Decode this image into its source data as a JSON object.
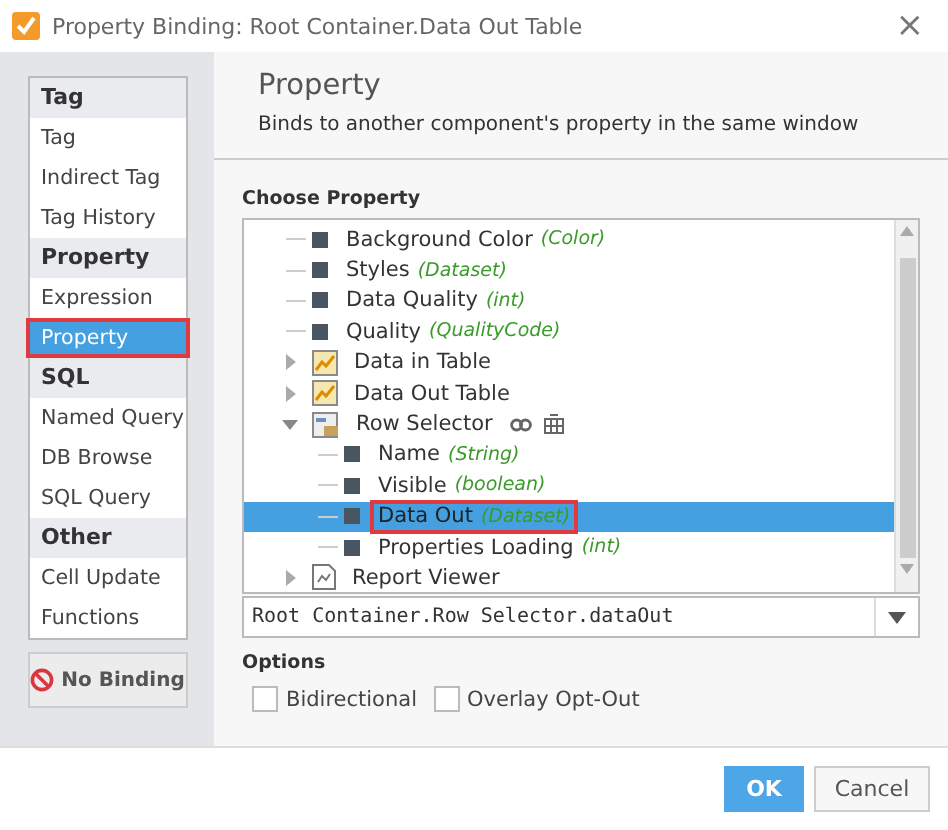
{
  "window": {
    "title": "Property Binding: Root Container.Data Out Table",
    "close": "×"
  },
  "sidebar": {
    "items": [
      {
        "kind": "header",
        "label": "Tag"
      },
      {
        "kind": "item",
        "label": "Tag",
        "selected": false,
        "outlined": false
      },
      {
        "kind": "item",
        "label": "Indirect Tag",
        "selected": false,
        "outlined": false
      },
      {
        "kind": "item",
        "label": "Tag History",
        "selected": false,
        "outlined": false
      },
      {
        "kind": "header",
        "label": "Property"
      },
      {
        "kind": "item",
        "label": "Expression",
        "selected": false,
        "outlined": false
      },
      {
        "kind": "item",
        "label": "Property",
        "selected": true,
        "outlined": true
      },
      {
        "kind": "header",
        "label": "SQL"
      },
      {
        "kind": "item",
        "label": "Named Query",
        "selected": false,
        "outlined": false
      },
      {
        "kind": "item",
        "label": "DB Browse",
        "selected": false,
        "outlined": false
      },
      {
        "kind": "item",
        "label": "SQL Query",
        "selected": false,
        "outlined": false
      },
      {
        "kind": "header",
        "label": "Other"
      },
      {
        "kind": "item",
        "label": "Cell Update",
        "selected": false,
        "outlined": false
      },
      {
        "kind": "item",
        "label": "Functions",
        "selected": false,
        "outlined": false
      }
    ],
    "no_binding": "No Binding"
  },
  "header": {
    "title": "Property",
    "subtitle": "Binds to another component's property in the same window"
  },
  "choose_property": {
    "label": "Choose Property",
    "tree": [
      {
        "kind": "property",
        "label": "Background Color",
        "type": "(Color)",
        "selected": false,
        "outlined": false
      },
      {
        "kind": "property",
        "label": "Styles",
        "type": "(Dataset)",
        "selected": false,
        "outlined": false
      },
      {
        "kind": "property",
        "label": "Data Quality",
        "type": "(int)",
        "selected": false,
        "outlined": false
      },
      {
        "kind": "property",
        "label": "Quality",
        "type": "(QualityCode)",
        "selected": false,
        "outlined": false
      },
      {
        "kind": "table",
        "label": "Data in Table",
        "expanded": false,
        "selected": false,
        "outlined": false
      },
      {
        "kind": "table",
        "label": "Data Out Table",
        "expanded": false,
        "selected": false,
        "outlined": false
      },
      {
        "kind": "component",
        "label": "Row Selector",
        "expanded": true,
        "selected": false,
        "outlined": false,
        "children": [
          {
            "kind": "property",
            "label": "Name",
            "type": "(String)",
            "selected": false,
            "outlined": false
          },
          {
            "kind": "property",
            "label": "Visible",
            "type": "(boolean)",
            "selected": false,
            "outlined": false
          },
          {
            "kind": "property",
            "label": "Data Out",
            "type": "(Dataset)",
            "selected": true,
            "outlined": true
          },
          {
            "kind": "property",
            "label": "Properties Loading",
            "type": "(int)",
            "selected": false,
            "outlined": false
          }
        ]
      },
      {
        "kind": "report",
        "label": "Report Viewer",
        "expanded": false,
        "selected": false,
        "outlined": false
      }
    ],
    "path": "Root Container.Row Selector.dataOut"
  },
  "options": {
    "label": "Options",
    "checkboxes": [
      {
        "label": "Bidirectional",
        "checked": false
      },
      {
        "label": "Overlay Opt-Out",
        "checked": false
      }
    ]
  },
  "buttons": [
    {
      "kind": "primary",
      "label": "OK"
    },
    {
      "kind": "secondary",
      "label": "Cancel"
    }
  ]
}
